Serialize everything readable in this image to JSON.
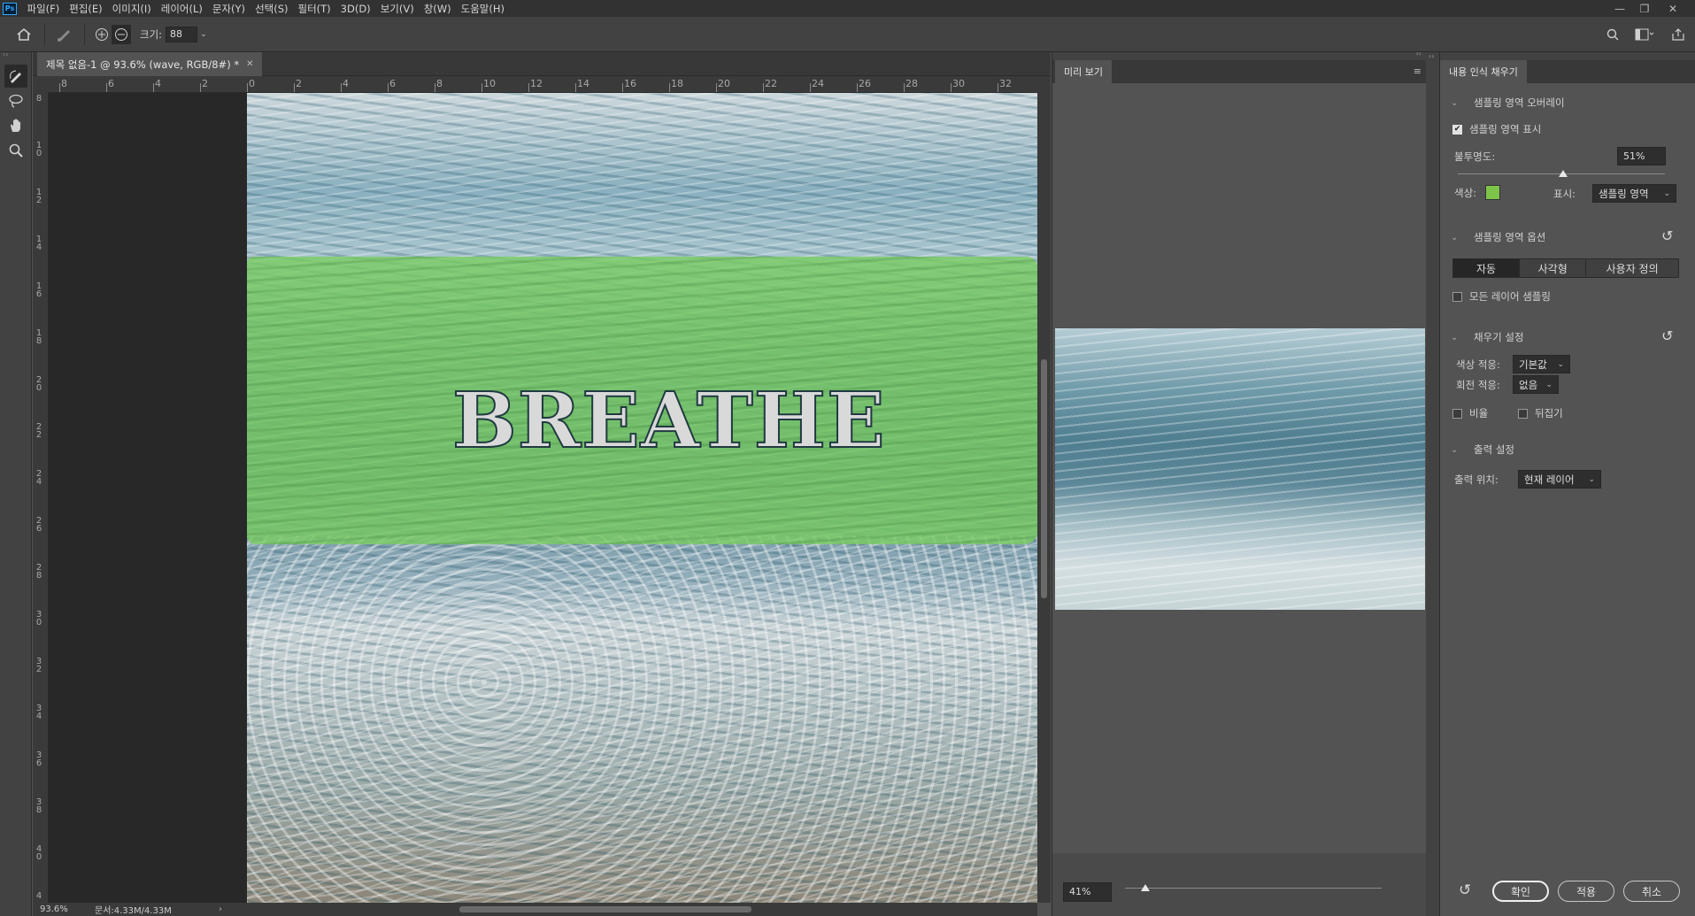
{
  "menubar": {
    "logo": "Ps",
    "items": [
      "파일(F)",
      "편집(E)",
      "이미지(I)",
      "레이어(L)",
      "문자(Y)",
      "선택(S)",
      "필터(T)",
      "3D(D)",
      "보기(V)",
      "창(W)",
      "도움말(H)"
    ]
  },
  "options_bar": {
    "size_label": "크기:",
    "size_value": "88"
  },
  "document": {
    "tab_title": "제목 없음-1 @ 93.6% (wave, RGB/8#) *",
    "canvas_text": "BREATHE",
    "zoom_status": "93.6%",
    "doc_status": "문서:4.33M/4.33M",
    "ruler_h_labels": [
      "8",
      "6",
      "4",
      "2",
      "0",
      "2",
      "4",
      "6",
      "8",
      "10",
      "12",
      "14",
      "16",
      "18",
      "20",
      "22",
      "24",
      "26",
      "28",
      "30",
      "32"
    ],
    "ruler_v_labels": [
      "8",
      "10",
      "12",
      "14",
      "16",
      "18",
      "20",
      "22",
      "24",
      "26",
      "28",
      "30",
      "32",
      "34",
      "36",
      "38",
      "40",
      "4"
    ]
  },
  "preview_panel": {
    "tab": "미리 보기",
    "zoom": "41%",
    "zoom_slider_fraction": 0.08
  },
  "content_aware_panel": {
    "tab": "내용 인식 채우기",
    "overlay_section": "샘플링 영역 오버레이",
    "show_sampling_label": "샘플링 영역 표시",
    "show_sampling_checked": true,
    "opacity_label": "불투명도:",
    "opacity_value": "51%",
    "opacity_fraction": 0.51,
    "color_label": "색상:",
    "overlay_color": "#7ec44a",
    "display_label": "표시:",
    "display_value": "샘플링 영역",
    "options_section": "샘플링 영역 옵션",
    "seg_options": [
      "자동",
      "사각형",
      "사용자 정의"
    ],
    "seg_selected": "자동",
    "all_layers_label": "모든 레이어 샘플링",
    "fill_section": "채우기 설정",
    "color_adapt_label": "색상 적응:",
    "color_adapt_value": "기본값",
    "rotation_adapt_label": "회전 적응:",
    "rotation_adapt_value": "없음",
    "scale_label": "비율",
    "mirror_label": "뒤집기",
    "output_section": "출력 설정",
    "output_label": "출력 위치:",
    "output_value": "현재 레이어",
    "ok_button": "확인",
    "apply_button": "적용",
    "cancel_button": "취소"
  }
}
